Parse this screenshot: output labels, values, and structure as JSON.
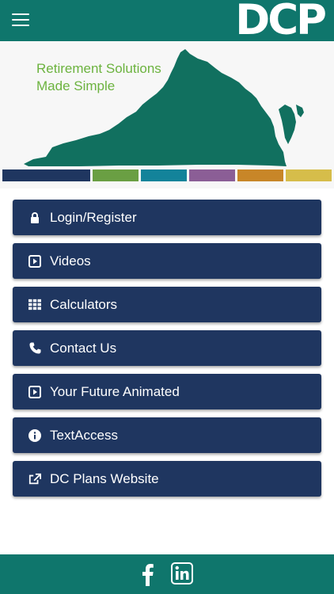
{
  "header": {
    "menu_icon": "hamburger-menu-icon",
    "logo_text": "DCP",
    "background": "#0f766c"
  },
  "hero": {
    "tagline_line1": "Retirement Solutions",
    "tagline_line2": "Made Simple",
    "tagline_color": "#6cb33f",
    "map_color": "#11705f",
    "stripe_colors": [
      "#1f3660",
      "#6a9f43",
      "#13839a",
      "#8b5e96",
      "#c88628",
      "#d6bd4a"
    ]
  },
  "menu": [
    {
      "label": "Login/Register",
      "icon": "lock-icon"
    },
    {
      "label": "Videos",
      "icon": "play-icon"
    },
    {
      "label": "Calculators",
      "icon": "grid-icon"
    },
    {
      "label": "Contact Us",
      "icon": "phone-icon"
    },
    {
      "label": "Your Future Animated",
      "icon": "play-icon"
    },
    {
      "label": "TextAccess",
      "icon": "info-icon"
    },
    {
      "label": "DC Plans Website",
      "icon": "external-link-icon"
    }
  ],
  "footer": {
    "social": [
      "facebook-icon",
      "linkedin-icon"
    ]
  },
  "colors": {
    "button": "#1f3660",
    "brand": "#0f766c"
  }
}
